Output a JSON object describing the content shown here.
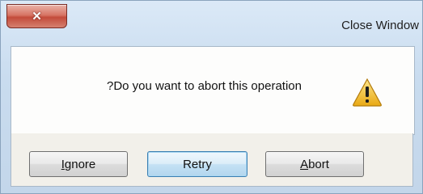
{
  "window": {
    "title": "Close Window",
    "close_glyph": "✕"
  },
  "dialog": {
    "message": "?Do you want to abort this operation",
    "icon": "warning-icon"
  },
  "buttons": [
    {
      "label_underlined": "I",
      "label_rest": "gnore"
    },
    {
      "label": "Retry"
    },
    {
      "label_underlined": "A",
      "label_rest": "bort"
    }
  ],
  "colors": {
    "close_button": "#c34b3b",
    "warning_fill": "#f3c42b",
    "focused_button_border": "#3c7fb1"
  }
}
